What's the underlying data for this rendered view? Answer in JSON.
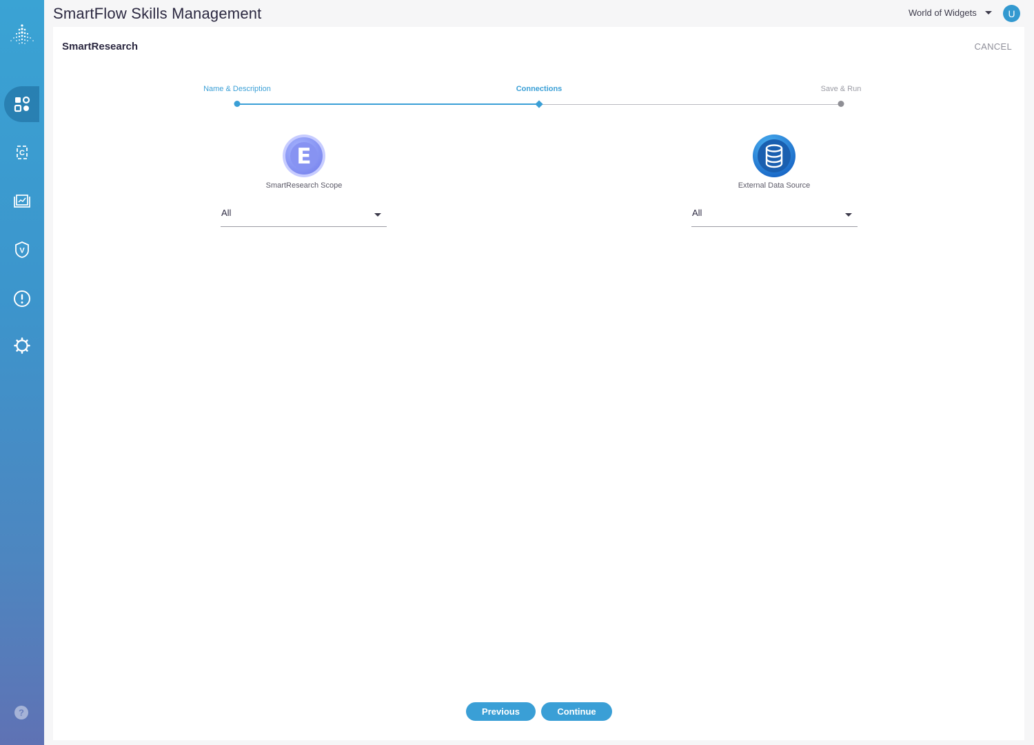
{
  "app": {
    "title": "SmartFlow Skills Management"
  },
  "header": {
    "org_name": "World of Widgets",
    "avatar_initial": "U"
  },
  "sidebar": {
    "items": [
      {
        "name": "skills",
        "icon": "apps-grid-icon",
        "active": true
      },
      {
        "name": "connections",
        "icon": "c-bracket-icon",
        "active": false
      },
      {
        "name": "reports",
        "icon": "dashboard-book-icon",
        "active": false
      },
      {
        "name": "versions",
        "icon": "v-badge-icon",
        "active": false
      },
      {
        "name": "alerts",
        "icon": "alert-circle-icon",
        "active": false
      },
      {
        "name": "settings",
        "icon": "gear-icon",
        "active": false
      }
    ]
  },
  "panel": {
    "title": "SmartResearch",
    "cancel_label": "CANCEL"
  },
  "stepper": {
    "steps": [
      {
        "label": "Name & Description",
        "state": "done"
      },
      {
        "label": "Connections",
        "state": "current"
      },
      {
        "label": "Save & Run",
        "state": "todo"
      }
    ]
  },
  "connectors": {
    "left": {
      "icon_letter": "E",
      "label": "SmartResearch Scope",
      "value": "All"
    },
    "right": {
      "icon": "database-icon",
      "label": "External Data Source",
      "value": "All"
    }
  },
  "actions": {
    "previous_label": "Previous",
    "continue_label": "Continue"
  },
  "colors": {
    "accent": "#3a9fd6",
    "sidebar_top": "#3aa3d4",
    "sidebar_bottom": "#5f72b4"
  }
}
